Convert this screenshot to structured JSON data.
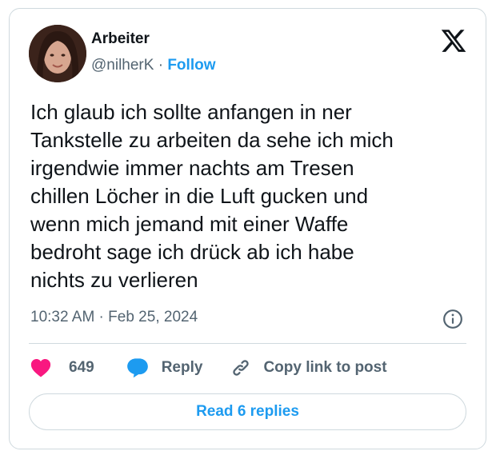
{
  "author": {
    "display_name": "Arbeiter",
    "handle": "@nilherK",
    "separator": "·",
    "follow_label": "Follow"
  },
  "tweet": {
    "lines": [
      "Ich glaub ich sollte anfangen in ner",
      "Tankstelle zu arbeiten da sehe ich mich",
      "irgendwie immer nachts am Tresen",
      "chillen Löcher in die Luft gucken und",
      "wenn mich jemand mit einer Waffe",
      "bedroht sage ich drück ab ich habe",
      "nichts zu verlieren"
    ],
    "timestamp": "10:32 AM · Feb 25, 2024"
  },
  "actions": {
    "like_count": "649",
    "reply_label": "Reply",
    "copy_link_label": "Copy link to post"
  },
  "read_replies_label": "Read 6 replies",
  "icons": {
    "logo": "x-logo-icon",
    "info": "info-icon",
    "like": "heart-icon",
    "reply": "speech-bubble-icon",
    "copy": "link-icon"
  },
  "colors": {
    "accent": "#1d9bf0",
    "like": "#f91880",
    "text": "#0f1419",
    "secondary": "#536471",
    "border": "#cfd9de"
  }
}
